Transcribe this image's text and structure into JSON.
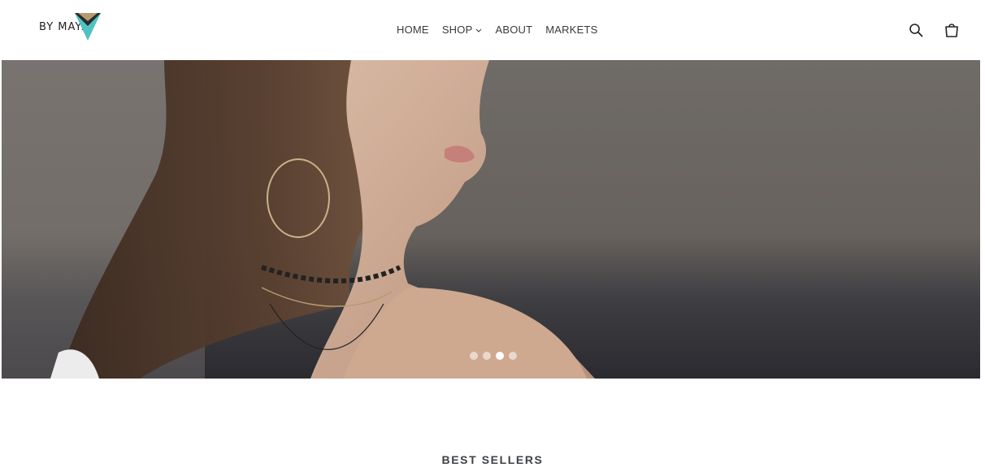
{
  "header": {
    "logo_text": "BY MAYA",
    "nav": [
      {
        "label": "HOME"
      },
      {
        "label": "SHOP"
      },
      {
        "label": "ABOUT"
      },
      {
        "label": "MARKETS"
      }
    ],
    "icons": [
      "search-icon",
      "cart-icon"
    ]
  },
  "hero": {
    "slides_count": 4,
    "active_slide": 3
  },
  "main": {
    "section_title": "BEST SELLERS"
  },
  "colors": {
    "logo_teal": "#4fc3c4",
    "logo_dark": "#222222",
    "nav_text": "#3a3a3a",
    "heading": "#3d4246"
  }
}
